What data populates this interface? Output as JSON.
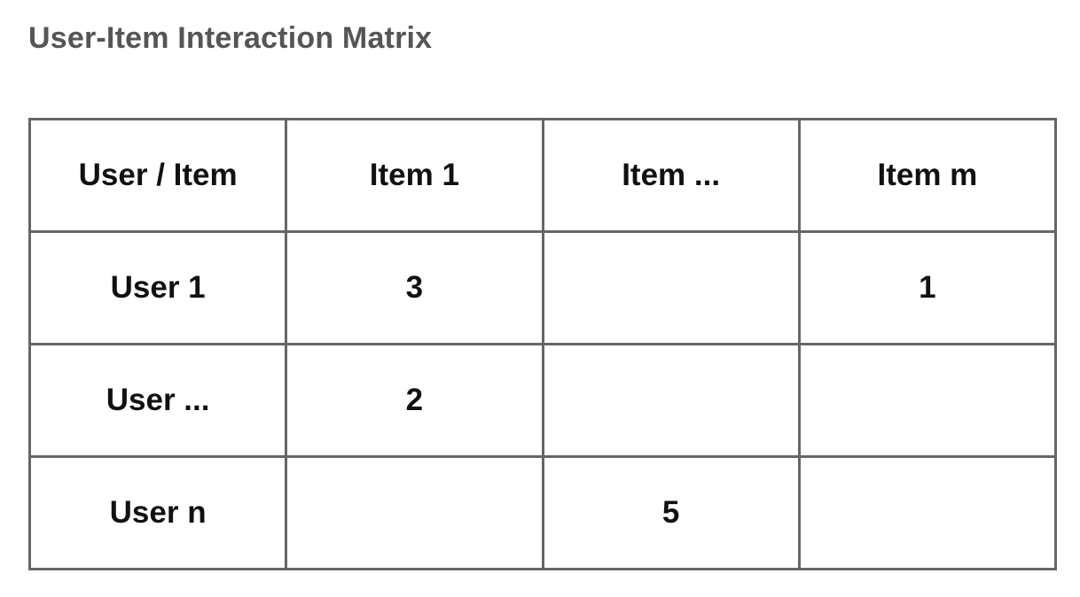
{
  "title": "User-Item Interaction Matrix",
  "matrix": {
    "corner_header": "User / Item",
    "columns": [
      "Item 1",
      "Item ...",
      "Item m"
    ],
    "rows": [
      {
        "label": "User 1",
        "cells": [
          "3",
          "",
          "1"
        ]
      },
      {
        "label": "User ...",
        "cells": [
          "2",
          "",
          ""
        ]
      },
      {
        "label": "User n",
        "cells": [
          "",
          "5",
          ""
        ]
      }
    ]
  }
}
